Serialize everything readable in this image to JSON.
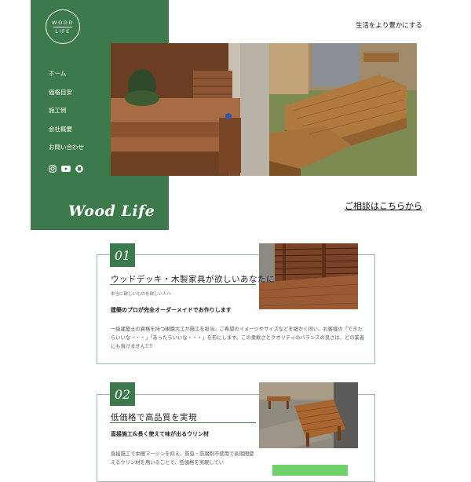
{
  "logo": {
    "line1": "WOOD",
    "line2": "LIFE"
  },
  "nav": [
    "ホーム",
    "価格目安",
    "施工例",
    "会社概要",
    "お問い合わせ"
  ],
  "social_icons": [
    "instagram-icon",
    "youtube-icon",
    "blog-icon"
  ],
  "brand": "Wood Life",
  "tagline": "生活をより豊かにする",
  "consult_link": "ご相談はこちらから",
  "section1": {
    "number": "01",
    "heading": "ウッドデッキ・木製家具が欲しいあなたに",
    "small": "本当に欲しいものを欲しい人へ",
    "subheading": "建築のプロが完全オーダーメイドでお作りします",
    "body": "一級建築士の資格を持つ現職大工が施工を担当。ご希望のイメージやサイズなどを細かく伺い、お客様の「できたらいいな・・・」「あったらいいな・・・」を形にします。この柔軟さとクオリティのバランスの良さは、どの業者にも負けません!!!!"
  },
  "section2": {
    "number": "02",
    "heading": "低価格で高品質を実現",
    "subheading": "直接施工&長く使えて味が出るウリン材",
    "body": "直接施工で中間マージンを抑え、防虫・防腐剤不使用で長期間使えるウリン材を用いることで、低価格を実現してい"
  },
  "colors": {
    "brand_green": "#3d7a4b",
    "button_green": "#6ed16a",
    "card_border": "#9cb8a4"
  }
}
